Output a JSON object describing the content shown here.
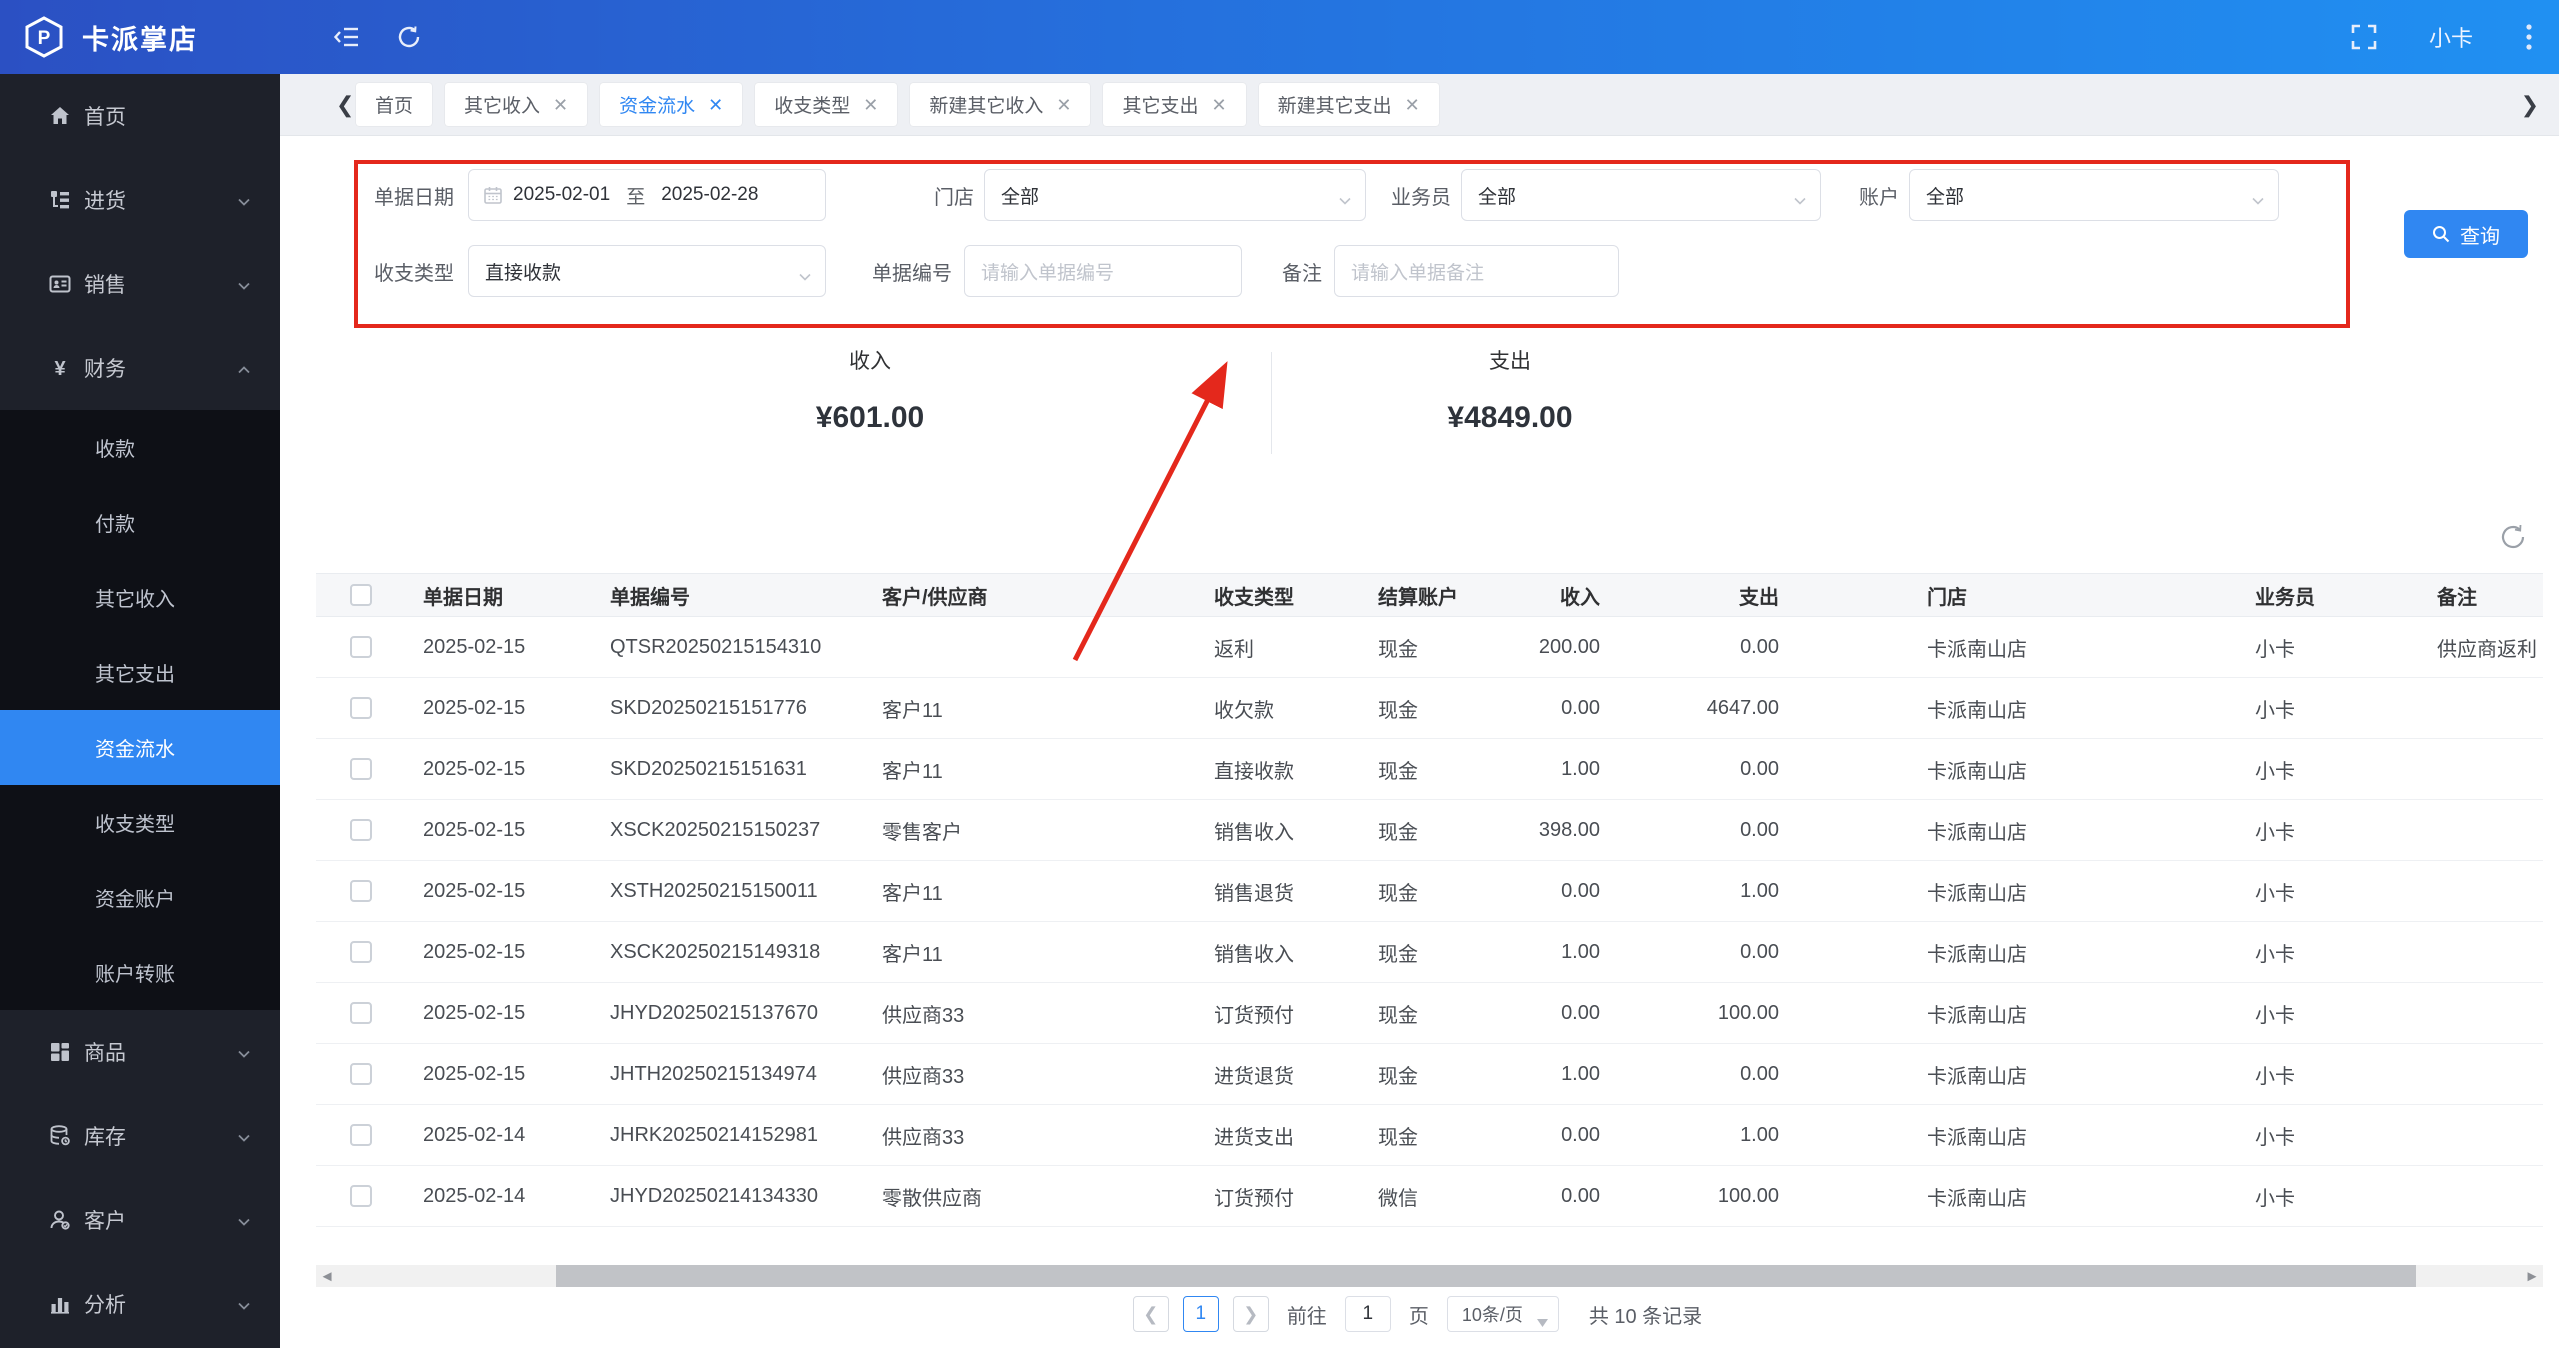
{
  "topbar": {
    "brand": "卡派掌店",
    "user": "小卡"
  },
  "sidebar": {
    "items": [
      {
        "label": "首页",
        "icon": "home-icon",
        "type": "top"
      },
      {
        "label": "进货",
        "icon": "purchase-icon",
        "type": "top",
        "chevron": "down"
      },
      {
        "label": "销售",
        "icon": "sales-icon",
        "type": "top",
        "chevron": "down"
      },
      {
        "label": "财务",
        "icon": "finance-icon",
        "type": "top",
        "chevron": "up"
      },
      {
        "label": "收款",
        "type": "sub"
      },
      {
        "label": "付款",
        "type": "sub"
      },
      {
        "label": "其它收入",
        "type": "sub"
      },
      {
        "label": "其它支出",
        "type": "sub"
      },
      {
        "label": "资金流水",
        "type": "sub",
        "active": true
      },
      {
        "label": "收支类型",
        "type": "sub"
      },
      {
        "label": "资金账户",
        "type": "sub"
      },
      {
        "label": "账户转账",
        "type": "sub"
      },
      {
        "label": "商品",
        "icon": "goods-icon",
        "type": "top",
        "chevron": "down"
      },
      {
        "label": "库存",
        "icon": "inventory-icon",
        "type": "top",
        "chevron": "down"
      },
      {
        "label": "客户",
        "icon": "customer-icon",
        "type": "top",
        "chevron": "down"
      },
      {
        "label": "分析",
        "icon": "analysis-icon",
        "type": "top",
        "chevron": "down"
      }
    ]
  },
  "tabs": [
    {
      "label": "首页"
    },
    {
      "label": "其它收入",
      "closable": true
    },
    {
      "label": "资金流水",
      "closable": true,
      "active": true
    },
    {
      "label": "收支类型",
      "closable": true
    },
    {
      "label": "新建其它收入",
      "closable": true
    },
    {
      "label": "其它支出",
      "closable": true
    },
    {
      "label": "新建其它支出",
      "closable": true
    }
  ],
  "filters": {
    "date_label": "单据日期",
    "date_from": "2025-02-01",
    "date_sep": "至",
    "date_to": "2025-02-28",
    "store_label": "门店",
    "store_value": "全部",
    "clerk_label": "业务员",
    "clerk_value": "全部",
    "account_label": "账户",
    "account_value": "全部",
    "type_label": "收支类型",
    "type_value": "直接收款",
    "docno_label": "单据编号",
    "docno_placeholder": "请输入单据编号",
    "remark_label": "备注",
    "remark_placeholder": "请输入单据备注",
    "search_button": "查询"
  },
  "summary": {
    "income_label": "收入",
    "income_value": "¥601.00",
    "expense_label": "支出",
    "expense_value": "¥4849.00"
  },
  "table": {
    "columns": [
      "单据日期",
      "单据编号",
      "客户/供应商",
      "收支类型",
      "结算账户",
      "收入",
      "支出",
      "门店",
      "业务员",
      "备注"
    ],
    "rows": [
      [
        "2025-02-15",
        "QTSR20250215154310",
        "",
        "返利",
        "现金",
        "200.00",
        "0.00",
        "卡派南山店",
        "小卡",
        "供应商返利"
      ],
      [
        "2025-02-15",
        "SKD20250215151776",
        "客户11",
        "收欠款",
        "现金",
        "0.00",
        "4647.00",
        "卡派南山店",
        "小卡",
        ""
      ],
      [
        "2025-02-15",
        "SKD20250215151631",
        "客户11",
        "直接收款",
        "现金",
        "1.00",
        "0.00",
        "卡派南山店",
        "小卡",
        ""
      ],
      [
        "2025-02-15",
        "XSCK20250215150237",
        "零售客户",
        "销售收入",
        "现金",
        "398.00",
        "0.00",
        "卡派南山店",
        "小卡",
        ""
      ],
      [
        "2025-02-15",
        "XSTH20250215150011",
        "客户11",
        "销售退货",
        "现金",
        "0.00",
        "1.00",
        "卡派南山店",
        "小卡",
        ""
      ],
      [
        "2025-02-15",
        "XSCK20250215149318",
        "客户11",
        "销售收入",
        "现金",
        "1.00",
        "0.00",
        "卡派南山店",
        "小卡",
        ""
      ],
      [
        "2025-02-15",
        "JHYD20250215137670",
        "供应商33",
        "订货预付",
        "现金",
        "0.00",
        "100.00",
        "卡派南山店",
        "小卡",
        ""
      ],
      [
        "2025-02-15",
        "JHTH20250215134974",
        "供应商33",
        "进货退货",
        "现金",
        "1.00",
        "0.00",
        "卡派南山店",
        "小卡",
        ""
      ],
      [
        "2025-02-14",
        "JHRK20250214152981",
        "供应商33",
        "进货支出",
        "现金",
        "0.00",
        "1.00",
        "卡派南山店",
        "小卡",
        ""
      ],
      [
        "2025-02-14",
        "JHYD20250214134330",
        "零散供应商",
        "订货预付",
        "微信",
        "0.00",
        "100.00",
        "卡派南山店",
        "小卡",
        ""
      ]
    ]
  },
  "pagination": {
    "page": "1",
    "goto_label": "前往",
    "goto_value": "1",
    "page_unit": "页",
    "page_size": "10条/页",
    "total": "共 10 条记录"
  },
  "colors": {
    "accent": "#3087f2",
    "annotation": "#e4281c",
    "topbar_left": "#2b50c3",
    "topbar_right": "#2090f2"
  }
}
